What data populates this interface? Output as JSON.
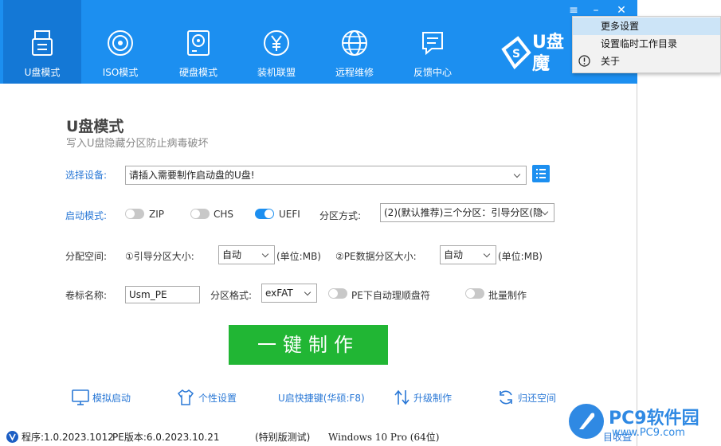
{
  "nav": {
    "items": [
      {
        "label": "U盘模式",
        "icon": "usb-drive-icon"
      },
      {
        "label": "ISO模式",
        "icon": "disc-icon"
      },
      {
        "label": "硬盘模式",
        "icon": "hard-disk-icon"
      },
      {
        "label": "装机联盟",
        "icon": "yuan-coin-icon"
      },
      {
        "label": "远程维修",
        "icon": "globe-icon"
      },
      {
        "label": "反馈中心",
        "icon": "chat-bubble-icon"
      }
    ],
    "active_index": 0,
    "logo_text": "U盘魔"
  },
  "page": {
    "title": "U盘模式",
    "subtitle": "写入U盘隐藏分区防止病毒破坏"
  },
  "form": {
    "device_label": "选择设备:",
    "device_value": "请插入需要制作启动盘的U盘!",
    "boot_label": "启动模式:",
    "boot_zip": "ZIP",
    "boot_chs": "CHS",
    "boot_uefi": "UEFI",
    "boot_zip_on": false,
    "boot_chs_on": false,
    "boot_uefi_on": true,
    "partition_method_label": "分区方式:",
    "partition_method_value": "(2)(默认推荐)三个分区：引导分区(隐",
    "space_label": "分配空间:",
    "boot_size_label": "①引导分区大小:",
    "boot_size_value": "自动",
    "boot_size_unit": "(单位:MB)",
    "pe_size_label": "②PE数据分区大小:",
    "pe_size_value": "自动",
    "pe_size_unit": "(单位:MB)",
    "volume_label": "卷标名称:",
    "volume_value": "Usm_PE",
    "fs_label": "分区格式:",
    "fs_value": "exFAT",
    "auto_sort_label": "PE下自动理顺盘符",
    "auto_sort_on": false,
    "batch_label": "批量制作",
    "batch_on": false
  },
  "action": {
    "make_label": "一键制作"
  },
  "tools": [
    {
      "label": "模拟启动",
      "icon": "monitor-icon"
    },
    {
      "label": "个性设置",
      "icon": "tshirt-icon"
    },
    {
      "label": "U启快捷键(华硕:F8)",
      "icon": ""
    },
    {
      "label": "升级制作",
      "icon": "upgrade-arrows-icon"
    },
    {
      "label": "归还空间",
      "icon": "refresh-icon"
    }
  ],
  "status": {
    "program": "程序:1.0.2023.1012",
    "pe_version": "PE版本:6.0.2023.10.21",
    "edition": "(特别版测试)",
    "os": "Windows 10 Pro (64位)",
    "docs": "目收益"
  },
  "menu": {
    "items": [
      "更多设置",
      "设置临时工作目录",
      "关于"
    ],
    "highlighted_index": 0
  },
  "watermark": {
    "text": "PC9软件园",
    "url": "www.PC9.com"
  },
  "colors": {
    "header": "#1c8ff0",
    "header_active": "#1478d6",
    "make_button": "#21b634",
    "link": "#2a78d6"
  }
}
